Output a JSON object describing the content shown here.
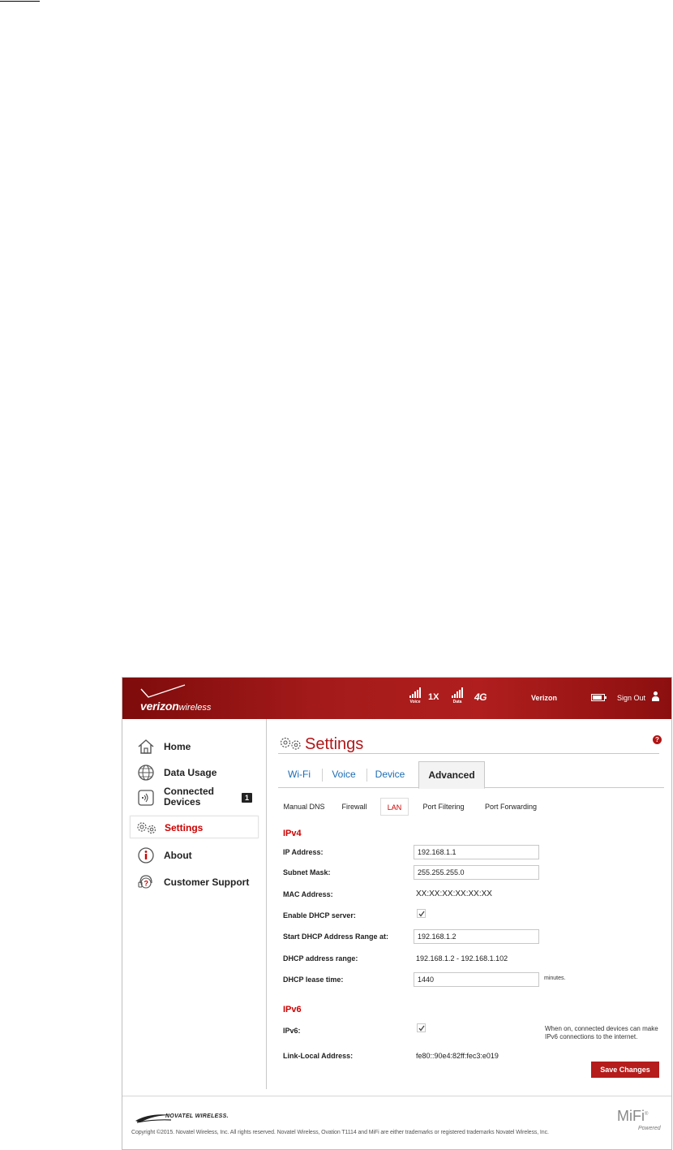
{
  "header": {
    "brand_bold": "verizon",
    "brand_light": "wireless",
    "voice_label": "Voice",
    "voice_net": "1X",
    "data_label": "Data",
    "data_net": "4G",
    "carrier": "Verizon",
    "signout": "Sign Out"
  },
  "sidebar": {
    "items": [
      {
        "label": "Home",
        "icon": "home-icon"
      },
      {
        "label": "Data Usage",
        "icon": "globe-icon"
      },
      {
        "label": "Connected Devices",
        "label_line1": "Connected",
        "label_line2": "Devices",
        "icon": "devices-icon",
        "badge": "1"
      },
      {
        "label": "Settings",
        "icon": "gears-icon",
        "active": true
      },
      {
        "label": "About",
        "icon": "info-icon"
      },
      {
        "label": "Customer Support",
        "icon": "support-icon"
      }
    ]
  },
  "main": {
    "title": "Settings",
    "help": "?",
    "tabs": [
      "Wi-Fi",
      "Voice",
      "Device",
      "Advanced"
    ],
    "active_tab": "Advanced",
    "subtabs": [
      "Manual DNS",
      "Firewall",
      "LAN",
      "Port Filtering",
      "Port Forwarding"
    ],
    "active_subtab": "LAN",
    "ipv4": {
      "heading": "IPv4",
      "ip_label": "IP Address:",
      "ip_value": "192.168.1.1",
      "subnet_label": "Subnet Mask:",
      "subnet_value": "255.255.255.0",
      "mac_label": "MAC Address:",
      "mac_value": "XX:XX:XX:XX:XX:XX",
      "dhcp_label": "Enable DHCP server:",
      "dhcp_enabled": true,
      "start_label": "Start DHCP Address Range at:",
      "start_value": "192.168.1.2",
      "range_label": "DHCP address range:",
      "range_value": "192.168.1.2 - 192.168.1.102",
      "lease_label": "DHCP lease time:",
      "lease_value": "1440",
      "lease_suffix": "minutes."
    },
    "ipv6": {
      "heading": "IPv6",
      "ipv6_label": "IPv6:",
      "ipv6_enabled": true,
      "note": "When on, connected devices can make IPv6 connections to the internet.",
      "link_local_label": "Link-Local Address:",
      "link_local_value": "fe80::90e4:82ff:fec3:e019"
    },
    "save_label": "Save Changes"
  },
  "footer": {
    "vendor": "NOVATEL WIRELESS.",
    "copyright": "Copyright ©2015. Novatel Wireless, Inc. All rights reserved. Novatel Wireless, Ovation T1114 and MiFi are either trademarks or registered trademarks Novatel Wireless, Inc.",
    "mifi": "MiFi",
    "powered": "Powered"
  },
  "colors": {
    "brand_red": "#b0171a",
    "header_red": "#a31a1a",
    "link_blue": "#1b6cb5"
  }
}
